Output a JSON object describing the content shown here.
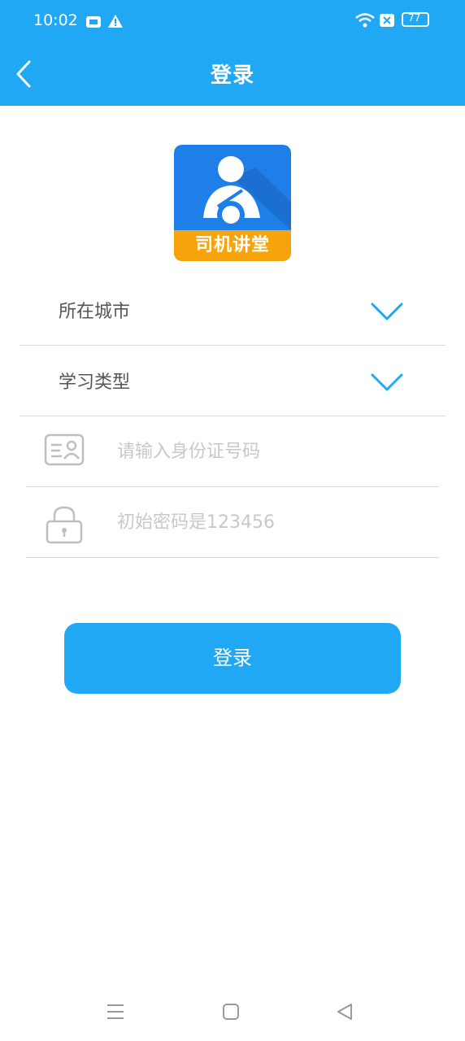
{
  "status": {
    "time": "10:02",
    "battery": "77"
  },
  "header": {
    "title": "登录"
  },
  "logo": {
    "caption": "司机讲堂"
  },
  "form": {
    "city_label": "所在城市",
    "study_type_label": "学习类型",
    "id_placeholder": "请输入身份证号码",
    "password_placeholder": "初始密码是123456",
    "login_label": "登录"
  },
  "colors": {
    "primary": "#21a8f5",
    "logo_blue": "#1f7fe8",
    "logo_orange": "#f7a30c"
  },
  "icons": [
    "back-arrow-icon",
    "chevron-down-icon",
    "id-card-icon",
    "lock-icon",
    "menu-icon",
    "home-icon",
    "back-icon"
  ]
}
